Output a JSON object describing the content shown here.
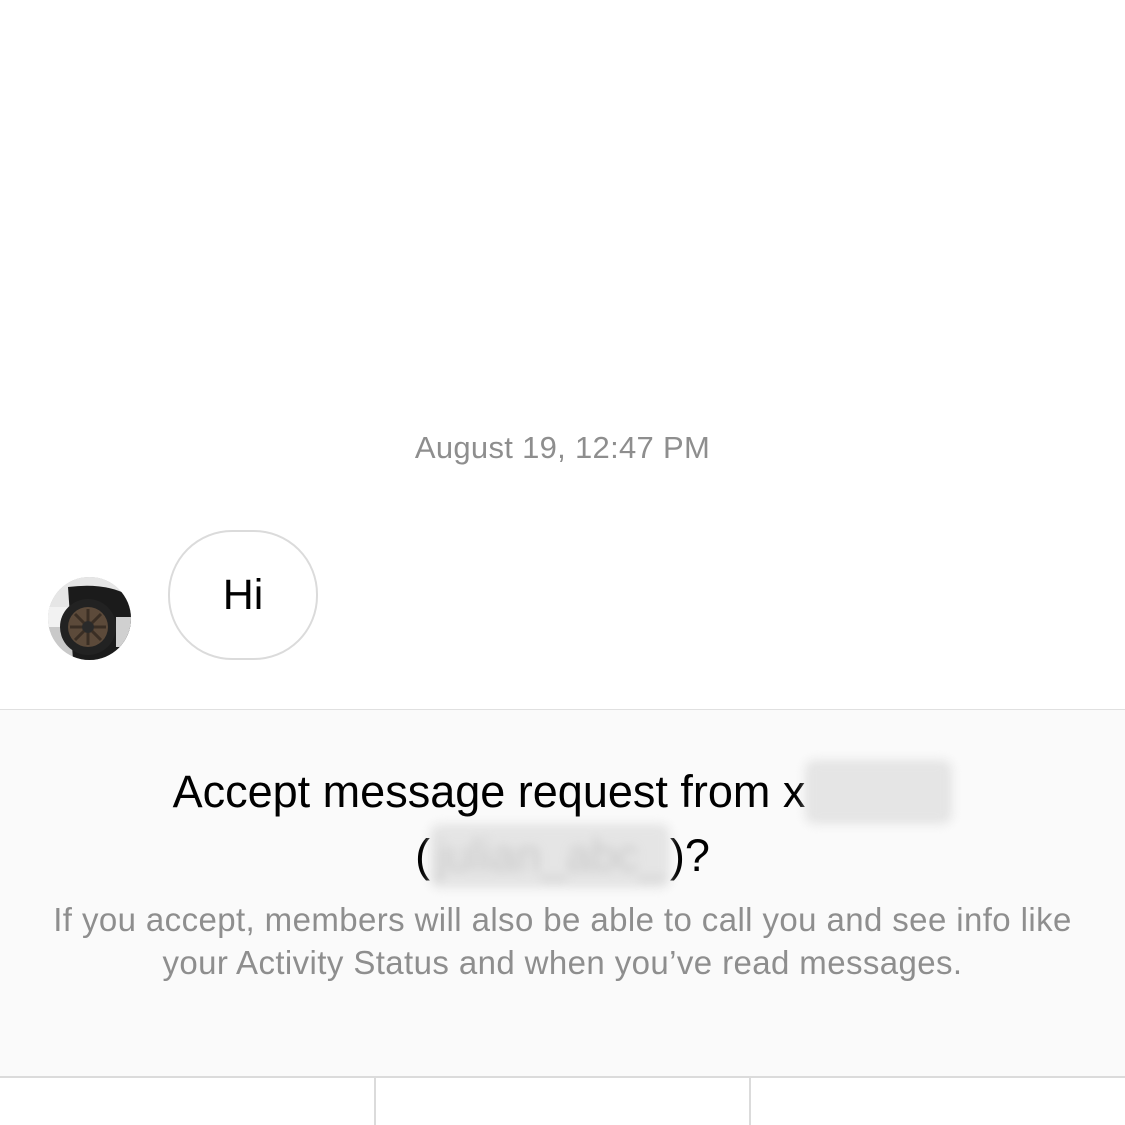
{
  "thread": {
    "timestamp": "August 19, 12:47 PM",
    "messages": [
      {
        "sender": "other",
        "text": "Hi"
      }
    ],
    "sender_avatar_icon": "car-wheel-photo"
  },
  "request": {
    "title_prefix": "Accept message request from ",
    "name_redacted": "x",
    "username_redacted": "julian_abc_",
    "title_suffix": "?",
    "body": "If you accept, members will also be able to call you and see info like your Activity Status and when you’ve read messages."
  },
  "colors": {
    "secondary_text": "#8e8e8e",
    "panel_background": "#fafafa",
    "divider": "#dbdbdb"
  }
}
